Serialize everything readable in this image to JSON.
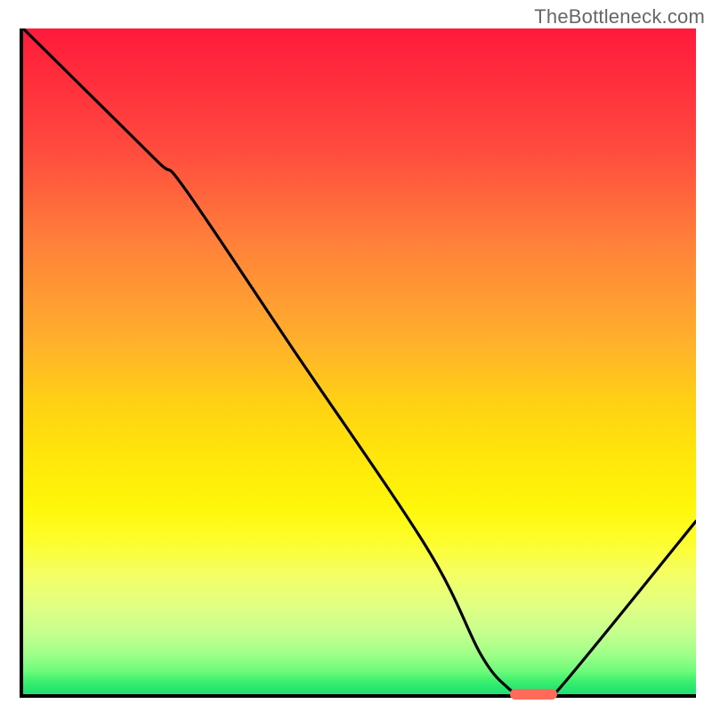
{
  "watermark": "TheBottleneck.com",
  "chart_data": {
    "type": "line",
    "title": "",
    "xlabel": "",
    "ylabel": "",
    "xlim": [
      0,
      100
    ],
    "ylim": [
      0,
      100
    ],
    "grid": false,
    "series": [
      {
        "name": "bottleneck-curve",
        "x": [
          0,
          8,
          20,
          24,
          40,
          60,
          68,
          72,
          74,
          78,
          80,
          100
        ],
        "y": [
          100,
          92,
          80,
          76,
          52,
          22,
          6,
          1,
          0.3,
          0.3,
          1.2,
          26
        ]
      }
    ],
    "annotations": [
      {
        "name": "optimum-marker",
        "x_range": [
          72,
          79
        ],
        "y": 0.5
      }
    ],
    "gradient_stops": [
      {
        "pos": 0,
        "color": "#ff1a3c"
      },
      {
        "pos": 50,
        "color": "#ffcf18"
      },
      {
        "pos": 78,
        "color": "#fcff30"
      },
      {
        "pos": 100,
        "color": "#22de73"
      }
    ]
  }
}
